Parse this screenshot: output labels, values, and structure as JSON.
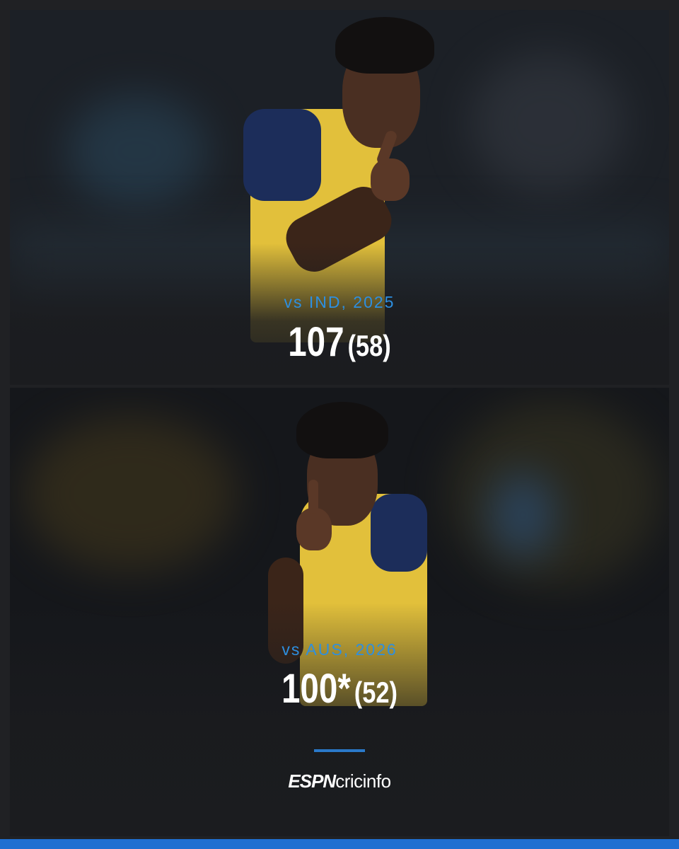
{
  "innings": [
    {
      "match": "vs IND, 2025",
      "runs": "107",
      "balls": "(58)"
    },
    {
      "match": "vs AUS, 2026",
      "runs": "100*",
      "balls": "(52)"
    }
  ],
  "brand": {
    "espn": "ESPN",
    "cricinfo": "cricinfo"
  },
  "colors": {
    "accent": "#2d8fe0",
    "bar": "#1f6fd1",
    "jersey": "#e2c03b",
    "navy": "#1c2d5a"
  }
}
